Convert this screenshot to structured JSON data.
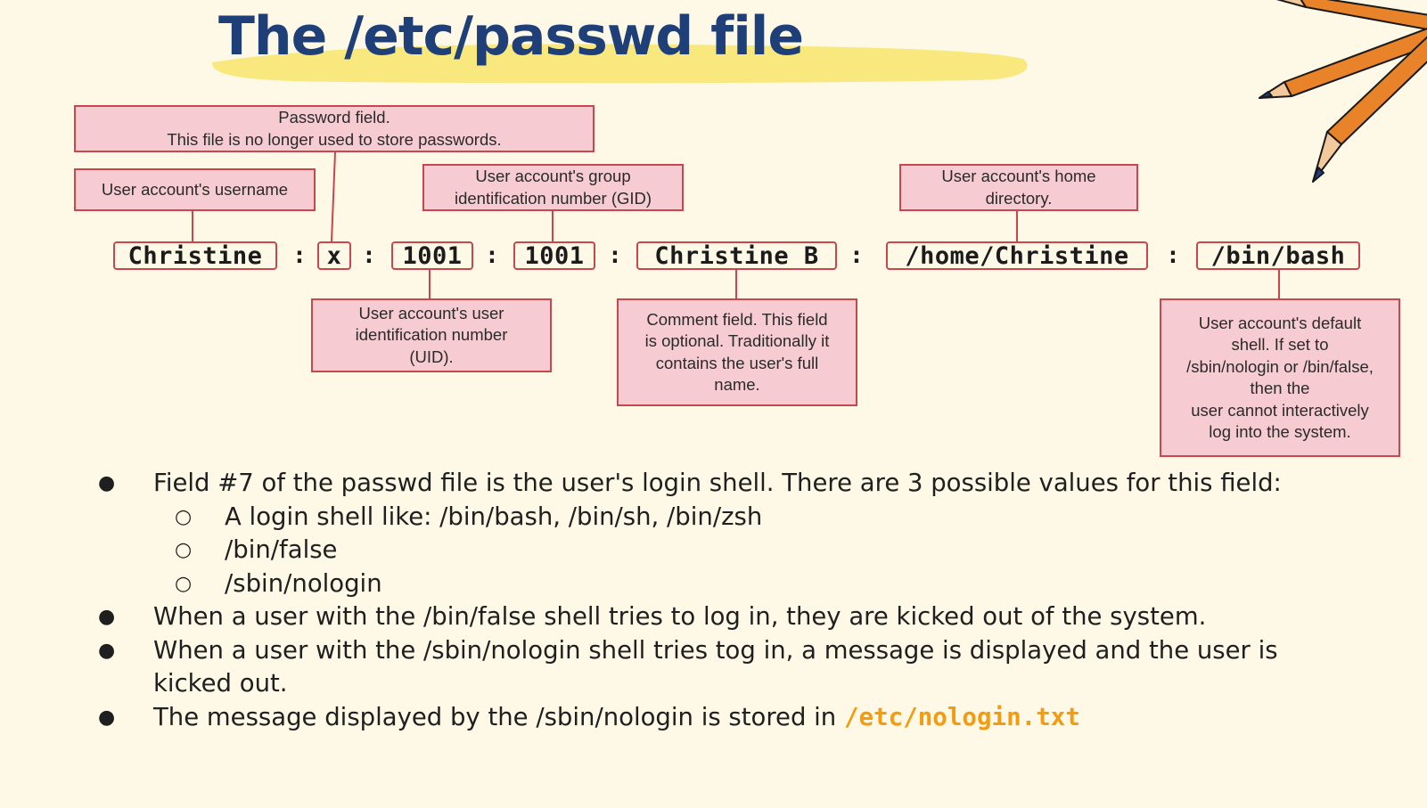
{
  "title": "The /etc/passwd file",
  "colors": {
    "title": "#1e3f78",
    "highlight": "#f7e56a",
    "callout_fill": "#f6ccd2",
    "callout_border": "#c9464c",
    "code_accent": "#f39c12",
    "background": "#fef9e6"
  },
  "decoration": {
    "icon": "pencils-icon"
  },
  "callouts": {
    "password": "Password field.\nThis file is no longer used to store passwords.",
    "username": "User account's username",
    "gid": "User account's group\nidentification number (GID)",
    "home": "User account's home\ndirectory.",
    "uid": "User account's user\nidentification number\n(UID).",
    "comment": "Comment field. This field\nis optional. Traditionally it\ncontains the user's full\nname.",
    "shell": "User account's default\nshell. If set to\n/sbin/nologin or /bin/false,\nthen the\nuser cannot interactively\nlog into the system."
  },
  "record": {
    "separator": ":",
    "fields": [
      "Christine",
      "x",
      "1001",
      "1001",
      "Christine B",
      "/home/Christine",
      "/bin/bash"
    ]
  },
  "bullets": {
    "b1": "Field #7 of the passwd file is the user's login shell. There are 3 possible values for this field:",
    "b1_sub": [
      "A login shell like: /bin/bash, /bin/sh, /bin/zsh",
      "/bin/false",
      "/sbin/nologin"
    ],
    "b2": "When a user with the /bin/false shell tries to log in, they are kicked out of the system.",
    "b3": "When a user with the /sbin/nologin shell tries tog in, a message is displayed and the user is kicked out.",
    "b4_text": "The message displayed by the /sbin/nologin is stored in ",
    "b4_code": "/etc/nologin.txt"
  }
}
